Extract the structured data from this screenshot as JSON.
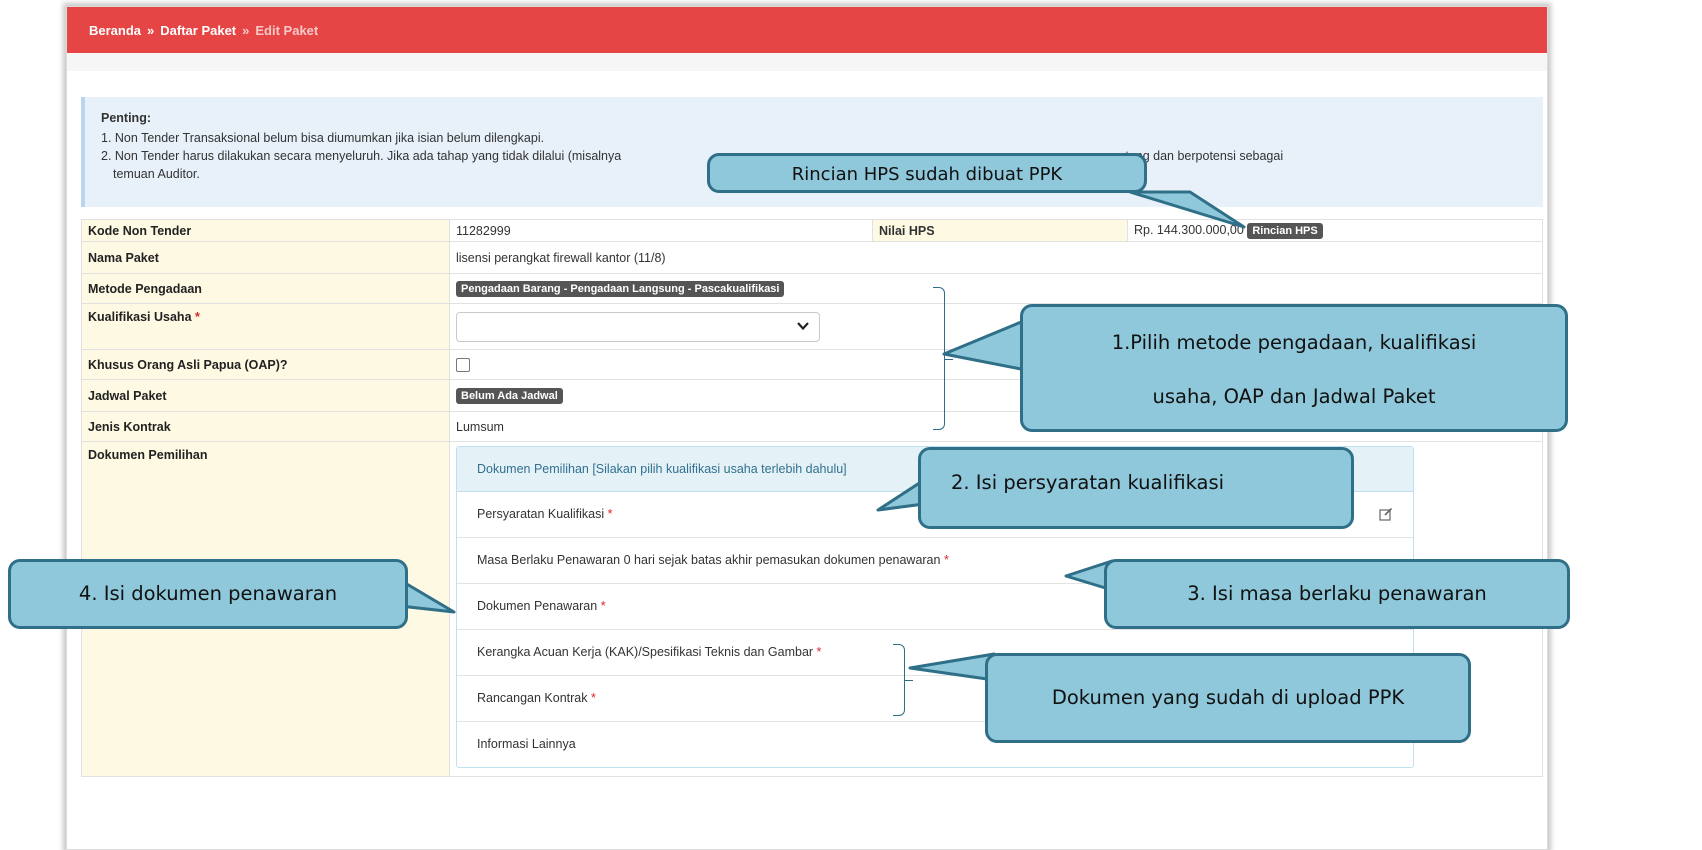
{
  "breadcrumb": {
    "home": "Beranda",
    "list": "Daftar Paket",
    "current": "Edit Paket",
    "separator": "»"
  },
  "notice": {
    "heading": "Penting:",
    "items": [
      "1. Non Tender Transaksional belum bisa diumumkan jika isian belum dilengkapi.",
      "2. Non Tender harus dilakukan secara menyeluruh. Jika ada tahap yang tidak dilalui (misalnya",
      "menggantung dan berpotensi sebagai",
      "temuan Auditor."
    ]
  },
  "form": {
    "kode_label": "Kode Non Tender",
    "kode_value": "11282999",
    "hps_label": "Nilai HPS",
    "hps_value": "Rp. 144.300.000,00",
    "hps_button": "Rincian HPS",
    "nama_label": "Nama Paket",
    "nama_value": "lisensi perangkat firewall kantor (11/8)",
    "metode_label": "Metode Pengadaan",
    "metode_value": "Pengadaan Barang - Pengadaan Langsung - Pascakualifikasi",
    "kualifikasi_label": "Kualifikasi Usaha",
    "required_mark": "*",
    "oap_label": "Khusus Orang Asli Papua (OAP)?",
    "jadwal_label": "Jadwal Paket",
    "jadwal_value": "Belum Ada Jadwal",
    "kontrak_label": "Jenis Kontrak",
    "kontrak_value": "Lumsum",
    "dokumen_label": "Dokumen Pemilihan"
  },
  "dokumen_panel": {
    "header": "Dokumen Pemilihan [Silakan pilih kualifikasi usaha terlebih dahulu]",
    "rows": [
      "Persyaratan Kualifikasi",
      "Masa Berlaku Penawaran 0 hari sejak batas akhir pemasukan dokumen penawaran",
      "Dokumen Penawaran",
      "Kerangka Acuan Kerja (KAK)/Spesifikasi Teknis dan Gambar",
      "Rancangan Kontrak",
      "Informasi Lainnya"
    ]
  },
  "callouts": {
    "hps": "Rincian HPS sudah dibuat PPK",
    "step1_line1": "1.Pilih metode pengadaan, kualifikasi",
    "step1_line2": "usaha, OAP dan Jadwal Paket",
    "step2": "2.   Isi  persyaratan kualifikasi",
    "step3": "3.   Isi  masa berlaku penawaran",
    "step4": "4.   Isi  dokumen penawaran",
    "uploaded": "Dokumen yang sudah di upload PPK"
  },
  "colors": {
    "topbar": "#e64545",
    "callout_fill": "#8ec8da",
    "callout_border": "#2f6f88",
    "label_bg": "#fdf9e3",
    "notice_bg": "#e8f1fa"
  }
}
